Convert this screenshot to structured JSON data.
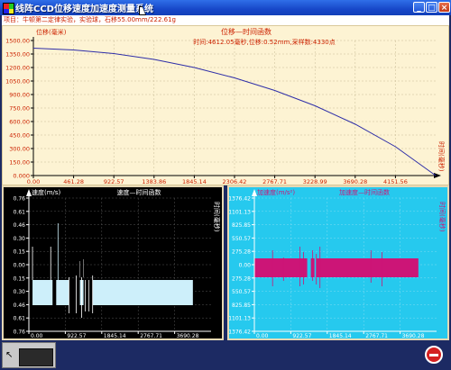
{
  "window": {
    "title": "线阵CCD位移速度加速度测量系统",
    "minimize_label": "_",
    "maximize_label": "□",
    "close_label": "×"
  },
  "info_bar": {
    "text": "项目：牛顿第二定律实验，实验球，石移55.00mm/222.61g"
  },
  "colors": {
    "title_bar": "#1747c9",
    "top_plot_bg": "#fdf3d3",
    "top_line": "#2e2ea8",
    "velocity_bg": "#000000",
    "velocity_signal": "#cdeffa",
    "accel_bg": "#26c9ee",
    "accel_signal": "#cc1577",
    "axis_label_red": "#cc2200"
  },
  "chart_data": [
    {
      "type": "line",
      "title": "位移—时间函数",
      "annotation": "时间:4612.05毫秒,位移:0.52mm,采样数:4330点",
      "ylabel": "位移(毫米)",
      "xlabel": "时间(毫秒)",
      "xlim": [
        0,
        4612.05
      ],
      "ylim": [
        0,
        1500
      ],
      "x_tick_labels": [
        "0.00",
        "461.28",
        "922.57",
        "1383.86",
        "1845.14",
        "2306.42",
        "2767.71",
        "3228.99",
        "3690.28",
        "4151.56"
      ],
      "y_tick_labels": [
        "1500.00",
        "1350.00",
        "1200.00",
        "1050.00",
        "900.00",
        "750.00",
        "600.00",
        "450.00",
        "300.00",
        "150.00",
        "0.000"
      ],
      "series": [
        {
          "x": [
            0,
            461.28,
            922.57,
            1383.86,
            1845.14,
            2306.42,
            2767.71,
            3228.99,
            3690.28,
            4151.56,
            4612.05
          ],
          "values": [
            1415,
            1395,
            1355,
            1290,
            1200,
            1085,
            945,
            775,
            570,
            320,
            0
          ]
        }
      ]
    },
    {
      "type": "area",
      "title": "速度—时间函数",
      "ylabel": "速度(m/s)",
      "xlabel": "时间(毫秒)",
      "xlim": [
        0,
        4612.05
      ],
      "y_tick_labels": [
        "0.76",
        "0.61",
        "0.46",
        "0.30",
        "0.15",
        "0.00",
        "0.15",
        "0.30",
        "0.46",
        "0.61",
        "0.76"
      ],
      "x_tick_labels": [
        "0.00",
        "922.57",
        "1845.14",
        "2767.71",
        "3690.28"
      ],
      "series": [
        {
          "x": [
            0,
            461.28,
            922.57,
            1383.86,
            1845.14,
            2306.42,
            2767.71,
            3228.99,
            3690.28,
            4151.56
          ],
          "values": [
            -0.26,
            -0.26,
            -0.27,
            -0.27,
            -0.28,
            -0.28,
            -0.29,
            -0.29,
            -0.29,
            -0.3
          ]
        }
      ]
    },
    {
      "type": "area",
      "title": "加速度—时间函数",
      "ylabel": "加速度(m/s²)",
      "xlabel": "时间(毫秒)",
      "xlim": [
        0,
        4612.05
      ],
      "y_tick_labels": [
        "1376.42",
        "1101.13",
        "825.85",
        "550.57",
        "275.28",
        "0.00",
        "275.28",
        "550.57",
        "825.85",
        "1101.13",
        "1376.42"
      ],
      "x_tick_labels": [
        "0.00",
        "922.57",
        "1845.14",
        "2767.71",
        "3690.28"
      ],
      "series": [
        {
          "x": [
            0,
            922.57,
            1845.14,
            2767.71,
            3690.28,
            4151.56
          ],
          "values": [
            -40,
            -40,
            -40,
            -40,
            -40,
            -40
          ]
        }
      ]
    }
  ]
}
